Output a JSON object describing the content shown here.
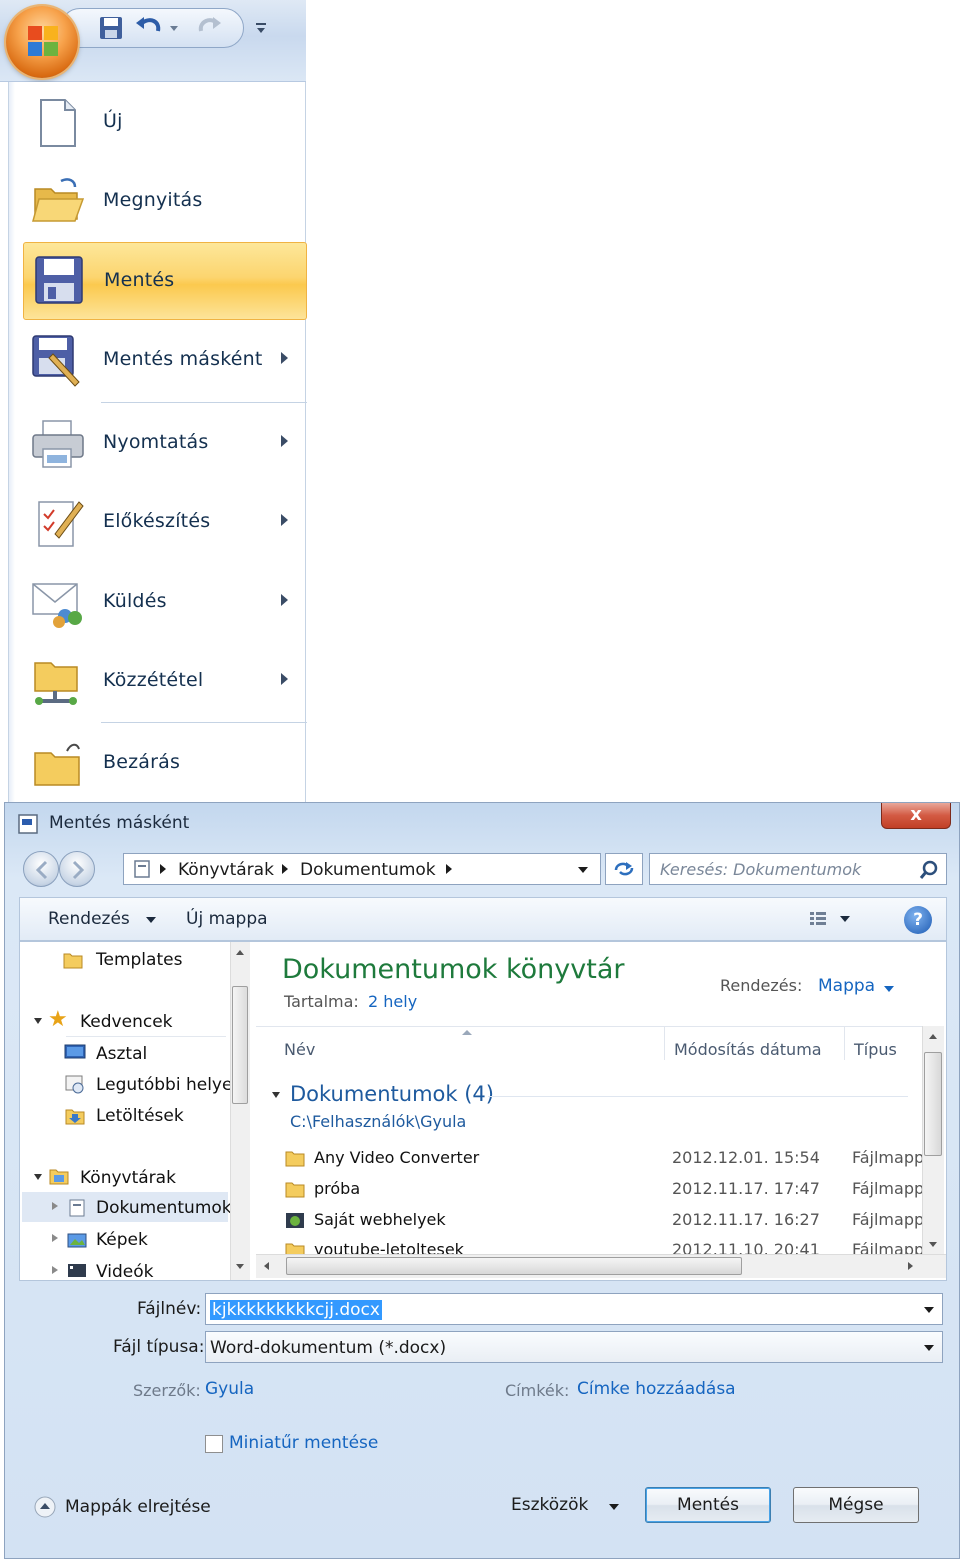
{
  "office_menu": {
    "items": [
      {
        "label": "Új",
        "icon": "new-document-icon",
        "submenu": false
      },
      {
        "label": "Megnyitás",
        "icon": "open-folder-icon",
        "submenu": false
      },
      {
        "label": "Mentés",
        "icon": "save-disk-icon",
        "submenu": false,
        "selected": true
      },
      {
        "label": "Mentés másként",
        "icon": "save-as-icon",
        "submenu": true
      },
      {
        "label": "Nyomtatás",
        "icon": "printer-icon",
        "submenu": true
      },
      {
        "label": "Előkészítés",
        "icon": "prepare-icon",
        "submenu": true
      },
      {
        "label": "Küldés",
        "icon": "send-icon",
        "submenu": true
      },
      {
        "label": "Közzététel",
        "icon": "publish-icon",
        "submenu": true
      },
      {
        "label": "Bezárás",
        "icon": "close-folder-icon",
        "submenu": false
      }
    ]
  },
  "dialog": {
    "title": "Mentés másként",
    "close_label": "x",
    "address": {
      "crumbs": [
        "Könyvtárak",
        "Dokumentumok"
      ]
    },
    "search": {
      "placeholder": "Keresés: Dokumentumok"
    },
    "toolbar": {
      "organize_label": "Rendezés",
      "new_folder_label": "Új mappa"
    },
    "nav_pane": {
      "items": [
        {
          "label": "Templates"
        },
        {
          "label": "Kedvencek"
        },
        {
          "label": "Asztal"
        },
        {
          "label": "Legutóbbi helyek"
        },
        {
          "label": "Letöltések"
        },
        {
          "label": "Könyvtárak"
        },
        {
          "label": "Dokumentumok"
        },
        {
          "label": "Képek"
        },
        {
          "label": "Videók"
        }
      ]
    },
    "library": {
      "title": "Dokumentumok könyvtár",
      "includes_label": "Tartalma:",
      "includes_value": "2 hely",
      "arrange_label": "Rendezés:",
      "arrange_value": "Mappa"
    },
    "columns": {
      "name": "Név",
      "date": "Módosítás dátuma",
      "type": "Típus"
    },
    "group": {
      "title": "Dokumentumok (4)",
      "path": "C:\\Felhasználók\\Gyula"
    },
    "files": [
      {
        "name": "Any Video Converter",
        "date": "2012.12.01. 15:54",
        "type": "Fájlmapp"
      },
      {
        "name": "próba",
        "date": "2012.11.17. 17:47",
        "type": "Fájlmapp"
      },
      {
        "name": "Saját webhelyek",
        "date": "2012.11.17. 16:27",
        "type": "Fájlmapp"
      },
      {
        "name": "youtube-letoltesek",
        "date": "2012.11.10. 20:41",
        "type": "Fájlmapp"
      }
    ],
    "form": {
      "filename_label": "Fájlnév:",
      "filename_value": "kjkkkkkkkkkcjj.docx",
      "filetype_label": "Fájl típusa:",
      "filetype_value": "Word-dokumentum (*.docx)",
      "authors_label": "Szerzők:",
      "authors_value": "Gyula",
      "tags_label": "Címkék:",
      "tags_value": "Címke hozzáadása",
      "thumbnail_label": "Miniatűr mentése",
      "thumbnail_checked": false
    },
    "footer": {
      "hide_folders_label": "Mappák elrejtése",
      "tools_label": "Eszközök",
      "save_label": "Mentés",
      "cancel_label": "Mégse"
    }
  }
}
